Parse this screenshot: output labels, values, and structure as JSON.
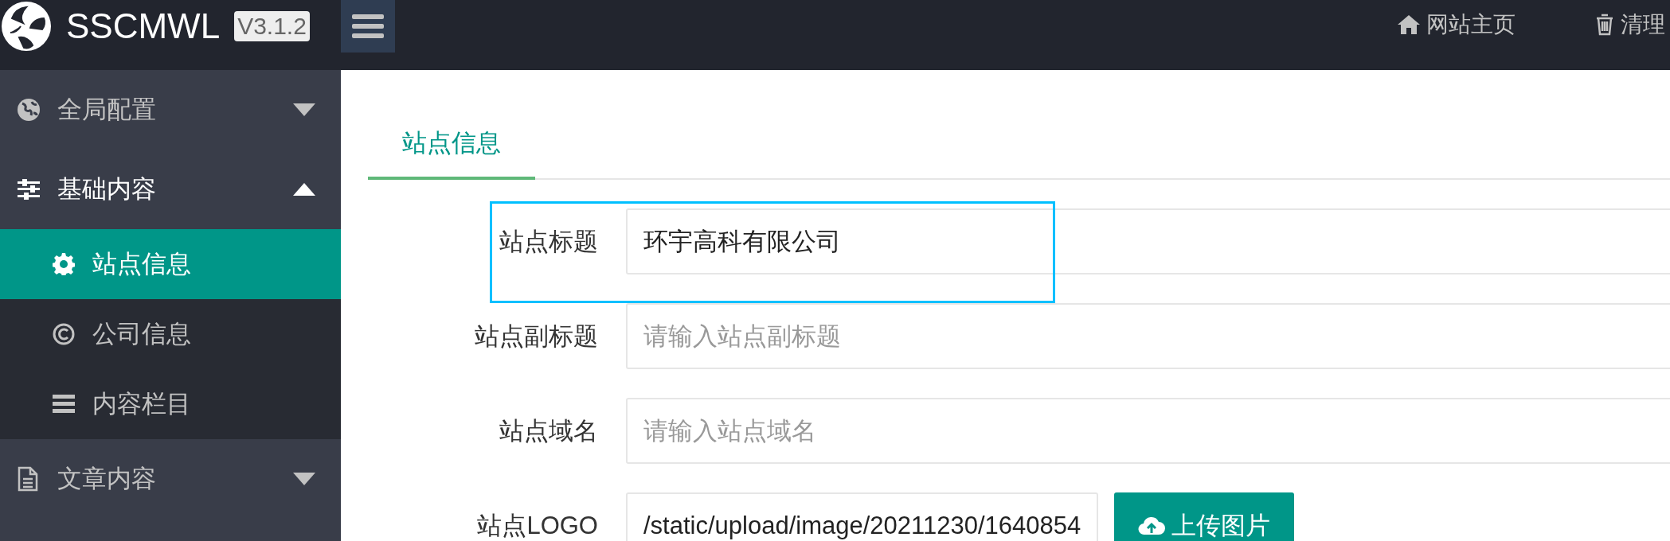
{
  "header": {
    "logo_text": "SSCMWL",
    "version": "V3.1.2",
    "links": [
      {
        "label": "网站主页"
      },
      {
        "label": "清理"
      }
    ]
  },
  "sidebar": {
    "items": [
      {
        "label": "全局配置",
        "expanded": false
      },
      {
        "label": "基础内容",
        "expanded": true,
        "children": [
          {
            "label": "站点信息",
            "selected": true
          },
          {
            "label": "公司信息",
            "selected": false
          },
          {
            "label": "内容栏目",
            "selected": false
          }
        ]
      },
      {
        "label": "文章内容",
        "expanded": false
      }
    ]
  },
  "tabs": [
    {
      "label": "站点信息",
      "selected": true
    }
  ],
  "form": {
    "fields": [
      {
        "label": "站点标题",
        "value": "环宇高科有限公司",
        "highlighted": true
      },
      {
        "label": "站点副标题",
        "placeholder": "请输入站点副标题",
        "highlighted": false
      },
      {
        "label": "站点域名",
        "placeholder": "请输入站点域名",
        "highlighted": false
      },
      {
        "label": "站点LOGO",
        "value": "/static/upload/image/20211230/1640854",
        "highlighted": false,
        "button": "上传图片"
      }
    ]
  }
}
